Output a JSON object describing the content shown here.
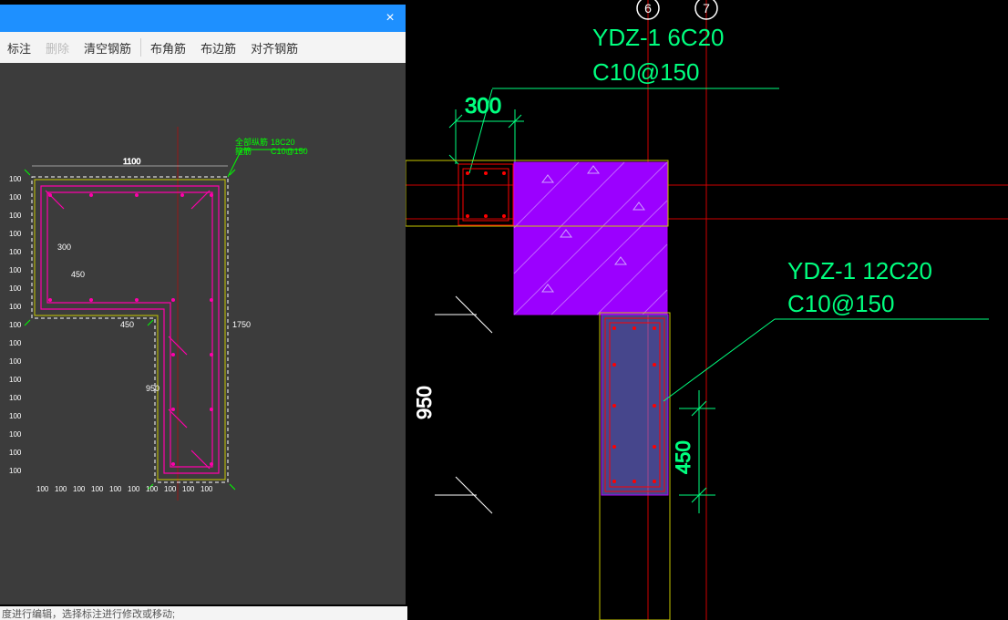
{
  "dialog": {
    "close": "×",
    "toolbar": {
      "label_annot": "标注",
      "label_delete": "删除",
      "label_clear": "清空钢筋",
      "label_corner": "布角筋",
      "label_edge": "布边筋",
      "label_align": "对齐钢筋"
    },
    "status": "度进行编辑，选择标注进行修改或移动;"
  },
  "mini": {
    "legend1": "全部纵筋",
    "legend2": "箍筋",
    "legend_val1": "18C20",
    "legend_val2": "C10@150",
    "dim_top": "1100",
    "dim_300": "300",
    "dim_450": "450",
    "dim_450b": "450",
    "dim_950": "950",
    "dim_1750": "1750",
    "dim_100": "100",
    "dim_100b": "100"
  },
  "main": {
    "grid6": "6",
    "grid7": "7",
    "label1_line1": "YDZ-1 6C20",
    "label1_line2": "C10@150",
    "label2_line1": "YDZ-1 12C20",
    "label2_line2": "C10@150",
    "dim_300": "300",
    "dim_950": "950",
    "dim_450": "450"
  }
}
